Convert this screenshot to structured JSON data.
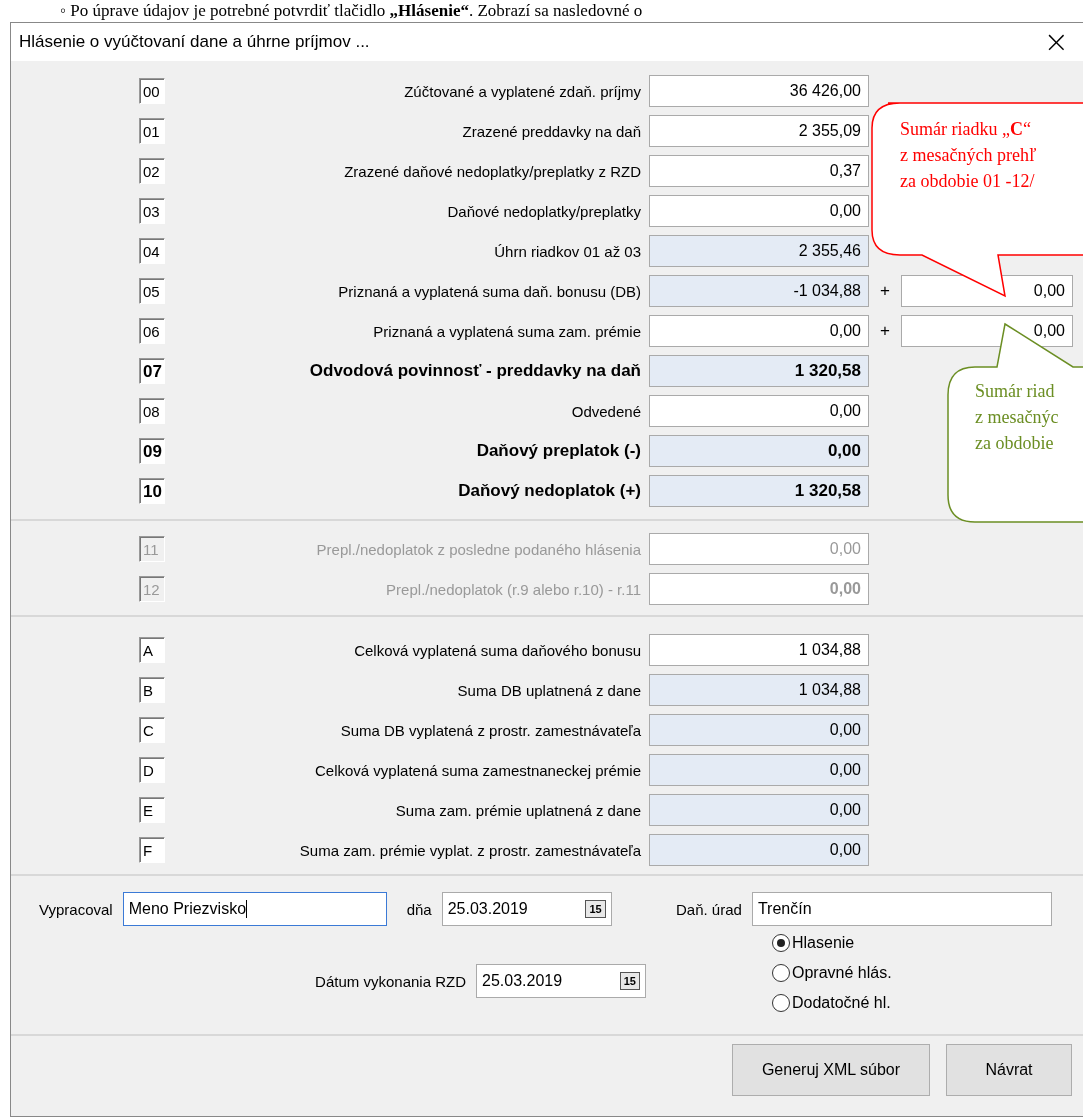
{
  "document_text": "◦ Po úprave údajov je potrebné potvrdiť tlačidlo **„Hlásenie“**. Zobrazí sa nasledovné o",
  "window": {
    "title": "Hlásenie o vyúčtovaní dane a úhrne príjmov ...",
    "close": "×"
  },
  "sections": [
    {
      "rows": [
        {
          "code": "00",
          "label": "Zúčtované a vyplatené zdaň. príjmy",
          "value": "36 426,00",
          "bold": false,
          "disabled": false,
          "readonly": false
        },
        {
          "code": "01",
          "label": "Zrazené preddavky na daň",
          "value": "2 355,09",
          "bold": false,
          "disabled": false,
          "readonly": false
        },
        {
          "code": "02",
          "label": "Zrazené daňové nedoplatky/preplatky z RZD",
          "value": "0,37",
          "bold": false,
          "disabled": false,
          "readonly": false
        },
        {
          "code": "03",
          "label": "Daňové nedoplatky/preplatky",
          "value": "0,00",
          "bold": false,
          "disabled": false,
          "readonly": false
        },
        {
          "code": "04",
          "label": "Úhrn riadkov 01 až 03",
          "value": "2 355,46",
          "bold": false,
          "disabled": false,
          "readonly": true
        },
        {
          "code": "05",
          "label": "Priznaná a vyplatená suma daň. bonusu (DB)",
          "value": "-1 034,88",
          "bold": false,
          "disabled": false,
          "readonly": true,
          "plus": "+",
          "extra_value": "0,00"
        },
        {
          "code": "06",
          "label": "Priznaná a vyplatená suma zam. prémie",
          "value": "0,00",
          "bold": false,
          "disabled": false,
          "readonly": false,
          "plus": "+",
          "extra_value": "0,00"
        },
        {
          "code": "07",
          "label": "Odvodová povinnosť - preddavky na daň",
          "value": "1 320,58",
          "bold": true,
          "disabled": false,
          "readonly": true
        },
        {
          "code": "08",
          "label": "Odvedené",
          "value": "0,00",
          "bold": false,
          "disabled": false,
          "readonly": false
        },
        {
          "code": "09",
          "label": "Daňový preplatok (-)",
          "value": "0,00",
          "bold": true,
          "disabled": false,
          "readonly": true
        },
        {
          "code": "10",
          "label": "Daňový nedoplatok (+)",
          "value": "1 320,58",
          "bold": true,
          "disabled": false,
          "readonly": true
        }
      ]
    },
    {
      "rows": [
        {
          "code": "11",
          "label": "Prepl./nedoplatok z posledne podaného hlásenia",
          "value": "0,00",
          "bold": false,
          "disabled": true,
          "readonly": false
        },
        {
          "code": "12",
          "label": "Prepl./nedoplatok (r.9 alebo r.10) - r.11",
          "value": "0,00",
          "bold": false,
          "value_bold": true,
          "disabled": true,
          "readonly": false
        }
      ]
    },
    {
      "rows": [
        {
          "code": "A",
          "label": "Celková vyplatená suma daňového bonusu",
          "value": "1 034,88",
          "bold": false,
          "disabled": false,
          "readonly": false
        },
        {
          "code": "B",
          "label": "Suma DB uplatnená z dane",
          "value": "1 034,88",
          "bold": false,
          "disabled": false,
          "readonly": true
        },
        {
          "code": "C",
          "label": "Suma DB vyplatená z prostr. zamestnávateľa",
          "value": "0,00",
          "bold": false,
          "disabled": false,
          "readonly": true
        },
        {
          "code": "D",
          "label": "Celková vyplatená suma zamestnaneckej prémie",
          "value": "0,00",
          "bold": false,
          "disabled": false,
          "readonly": true
        },
        {
          "code": "E",
          "label": "Suma zam. prémie uplatnená z dane",
          "value": "0,00",
          "bold": false,
          "disabled": false,
          "readonly": true
        },
        {
          "code": "F",
          "label": "Suma zam. prémie vyplat. z prostr. zamestnávateľa",
          "value": "0,00",
          "bold": false,
          "disabled": false,
          "readonly": true
        }
      ]
    }
  ],
  "prepared_by": {
    "label": "Vypracoval",
    "value": "Meno Priezvisko"
  },
  "date": {
    "label": "dňa",
    "value": "25.03.2019",
    "picker": "15"
  },
  "tax_office": {
    "label": "Daň. úrad",
    "value": "Trenčín"
  },
  "rzd_date": {
    "label": "Dátum vykonania RZD",
    "value": "25.03.2019",
    "picker": "15"
  },
  "report_types": [
    {
      "label": "Hlasenie",
      "selected": true
    },
    {
      "label": "Opravné hlás.",
      "selected": false
    },
    {
      "label": "Dodatočné hl.",
      "selected": false
    }
  ],
  "buttons": [
    "Generuj XML súbor",
    "Návrat"
  ],
  "callouts": [
    {
      "color": "#ff0000",
      "lines": [
        "Sumár riadku „**C**“",
        "z mesačných prehľ",
        "za obdobie 01 -12/"
      ]
    },
    {
      "color": "#6b8e23",
      "lines": [
        "Sumár riad",
        "z mesačnýc",
        "za obdobie"
      ]
    }
  ]
}
